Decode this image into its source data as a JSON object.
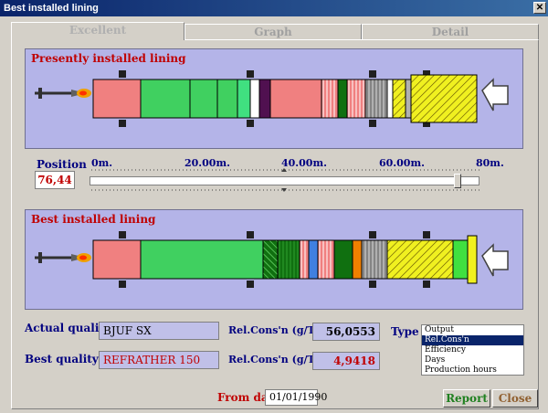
{
  "window": {
    "title": "Best installed lining",
    "close_glyph": "✕"
  },
  "tabs": [
    {
      "label": "Excellent",
      "active": true
    },
    {
      "label": "Graph",
      "active": false
    },
    {
      "label": "Detail",
      "active": false
    }
  ],
  "present": {
    "label": "Presently installed lining"
  },
  "best": {
    "label": "Best installed lining"
  },
  "position": {
    "label": "Position",
    "value": "76,44",
    "fraction": 0.955
  },
  "scale": {
    "ticks": [
      "0m.",
      "20.00m.",
      "40.00m.",
      "60.00m.",
      "80m."
    ]
  },
  "quality": {
    "actual_label": "Actual quality",
    "actual_value": "BJUF SX",
    "best_label": "Best quality",
    "best_value": "REFRATHER 150",
    "relcons_label_1": "Rel.Cons'n (g/T/m)",
    "relcons_value_1": "56,0553",
    "relcons_label_2": "Rel.Cons'n (g/T/m)",
    "relcons_value_2": "4,9418",
    "type_label": "Type",
    "type_options": [
      "Output",
      "Rel.Cons'n",
      "Efficiency",
      "Days",
      "Production hours"
    ],
    "type_selected": "Rel.Cons'n"
  },
  "footer": {
    "from_date_label": "From date",
    "from_date_value": "01/01/1990",
    "report_label": "Report",
    "close_label": "Close"
  },
  "colors": {
    "panel": "#b4b4e8",
    "pink": "#f08080",
    "green": "#40d060",
    "darkgreen": "#107010",
    "yellow": "#f0f020",
    "orange": "#f08000",
    "blue": "#4080e0",
    "gray": "#b0b0b0",
    "purple": "#501050",
    "label_red": "#c00000",
    "label_blue": "#000080"
  }
}
